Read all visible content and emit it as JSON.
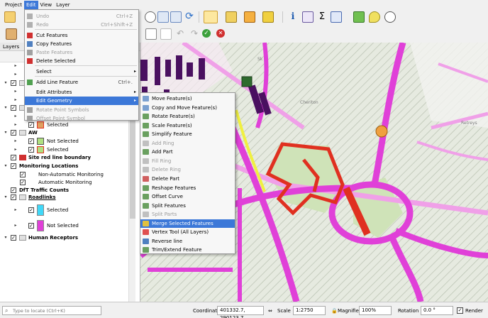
{
  "menubar": [
    "Project",
    "Edit",
    "View",
    "Layer"
  ],
  "edit_menu": {
    "items": [
      {
        "label": "Undo",
        "shortcut": "Ctrl+Z",
        "disabled": true
      },
      {
        "label": "Redo",
        "shortcut": "Ctrl+Shift+Z",
        "disabled": true
      },
      {
        "label": "Cut Features",
        "shortcut": "",
        "disabled": false
      },
      {
        "label": "Copy Features",
        "shortcut": "",
        "disabled": false
      },
      {
        "label": "Paste Features",
        "shortcut": "",
        "disabled": true
      },
      {
        "label": "Delete Selected",
        "shortcut": "",
        "disabled": false
      },
      {
        "label": "Select",
        "shortcut": "",
        "disabled": false
      },
      {
        "label": "Add Line Feature",
        "shortcut": "Ctrl+.",
        "disabled": false
      },
      {
        "label": "Edit Attributes",
        "shortcut": "",
        "disabled": false
      },
      {
        "label": "Edit Geometry",
        "shortcut": "",
        "disabled": false
      },
      {
        "label": "Rotate Point Symbols",
        "shortcut": "",
        "disabled": true
      },
      {
        "label": "Offset Point Symbol",
        "shortcut": "",
        "disabled": true
      }
    ]
  },
  "geometry_submenu": [
    "Move Feature(s)",
    "Copy and Move Feature(s)",
    "Rotate Feature(s)",
    "Scale Feature(s)",
    "Simplify Feature",
    "Add Ring",
    "Add Part",
    "Fill Ring",
    "Delete Ring",
    "Delete Part",
    "Reshape Features",
    "Offset Curve",
    "Split Features",
    "Split Parts",
    "Merge Selected Features",
    "Vertex Tool (All Layers)",
    "Reverse line",
    "Trim/Extend Feature"
  ],
  "layers_panel": {
    "title": "Layers",
    "rows": [
      {
        "label": "Not Selected"
      },
      {
        "label": "Selected"
      },
      {
        "label": "SPA"
      },
      {
        "label": "Not Selected"
      },
      {
        "label": "Selected"
      },
      {
        "label": "SSSI"
      },
      {
        "label": "Not Selected"
      },
      {
        "label": "Selected"
      },
      {
        "label": "AW"
      },
      {
        "label": "Not Selected"
      },
      {
        "label": "Selected"
      },
      {
        "label": "Site red line boundary"
      },
      {
        "label": "Monitoring Locations"
      },
      {
        "label": "Non-Automatic Monitoring"
      },
      {
        "label": "Automatic Monitoring"
      },
      {
        "label": "DfT Traffic Counts"
      },
      {
        "label": "Roadlinks"
      },
      {
        "label": "Selected"
      },
      {
        "label": "Not Selected"
      },
      {
        "label": "Human Receptors"
      }
    ]
  },
  "map_labels": [
    "Retreys",
    "Cheriton",
    "Sk"
  ],
  "statusbar": {
    "locate_placeholder": "Type to locate (Ctrl+K)",
    "coordinate_label": "Coordinate",
    "coordinate_value": "401332.7, 290123.7",
    "scale_label": "Scale",
    "scale_value": "1:2750",
    "magnifier_label": "Magnifier",
    "magnifier_value": "100%",
    "rotation_label": "Rotation",
    "rotation_value": "0.0 °",
    "render_label": "Render"
  },
  "colors": {
    "menu_highlight": "#3c78d8",
    "road_magenta": "#e040d8",
    "road_pink": "#f0a0e8",
    "selected_red": "#e03020",
    "building": "#4a1060",
    "greenspace": "#c8e0b0",
    "marker_orange": "#f0a040",
    "marker_green": "#2e6b2e",
    "selected_road": "#f0f040"
  }
}
